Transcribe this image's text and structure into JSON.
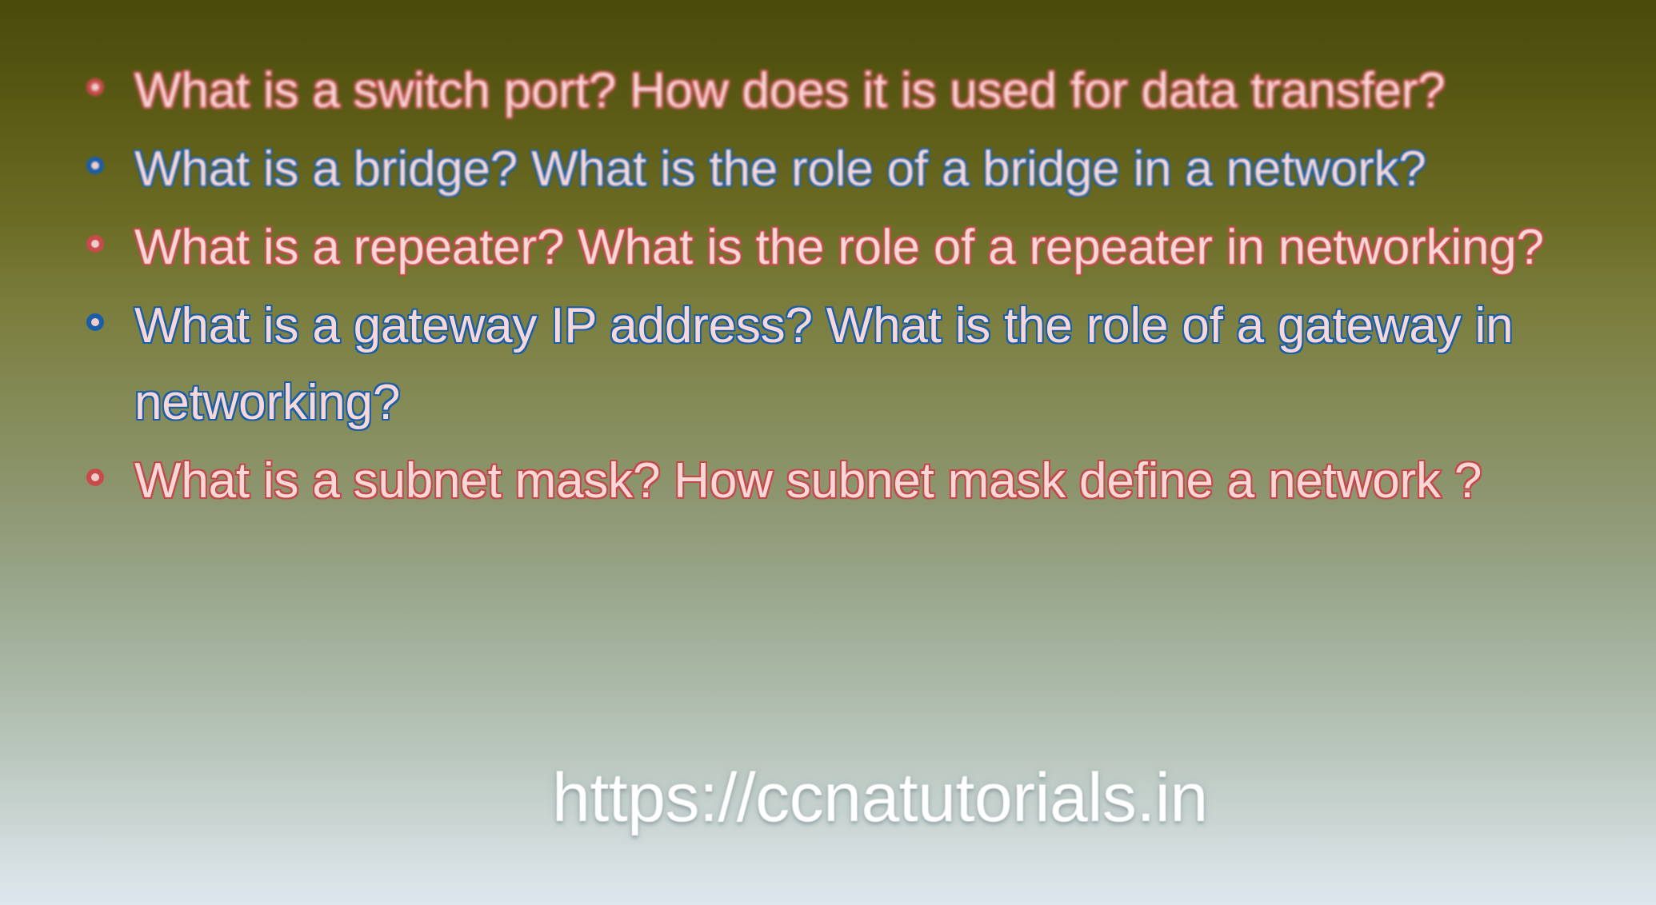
{
  "slide": {
    "background": {
      "type": "linear-gradient-vertical",
      "top_color": "#4b4b09",
      "mid_color": "#8d9670",
      "bottom_color": "#dee6ee"
    },
    "palette": {
      "text_fill": "#f7d7d7",
      "red_outline": "#c44a4a",
      "blue_outline": "#1a5ea8",
      "watermark_color": "#ffffff"
    },
    "bullets": [
      {
        "text": "What is a switch port? How does it is used for data transfer?",
        "color": "red",
        "marker": "filled-circle-bullet"
      },
      {
        "text": "What is a bridge? What is the role of a bridge in a network?",
        "color": "blue",
        "marker": "filled-circle-bullet"
      },
      {
        "text": "What is a repeater? What is the role of a repeater in networking?",
        "color": "red",
        "marker": "filled-circle-bullet"
      },
      {
        "text": "What is a gateway IP address? What is the role of a gateway in networking?",
        "color": "blue",
        "marker": "filled-circle-bullet"
      },
      {
        "text": "What is a subnet mask? How subnet mask define a network ?",
        "color": "red",
        "marker": "filled-circle-bullet"
      }
    ],
    "watermark": {
      "text": "https://ccnatutorials.in"
    }
  }
}
